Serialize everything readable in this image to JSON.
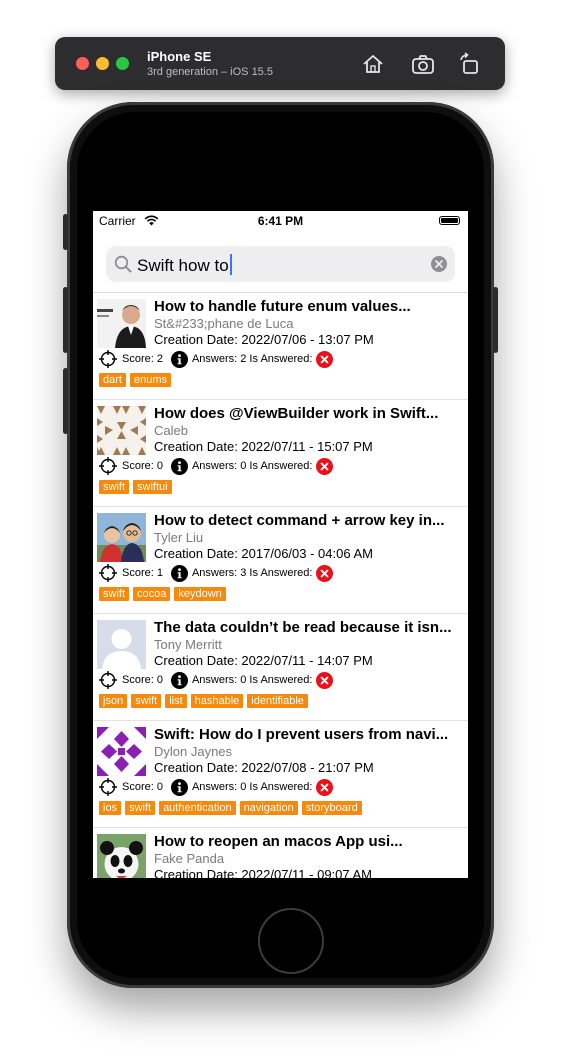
{
  "simulator": {
    "device_name": "iPhone SE",
    "device_subtitle": "3rd generation – iOS 15.5"
  },
  "status_bar": {
    "carrier": "Carrier",
    "time": "6:41 PM"
  },
  "search": {
    "query": "Swift how to"
  },
  "colors": {
    "tag_background": "#f7890c",
    "unanswered_badge": "#e8121b",
    "caret": "#3478f6"
  },
  "questions": [
    {
      "title": "How to handle future enum values...",
      "author": "St&#233;phane de Luca",
      "date": "Creation Date: 2022/07/06 - 13:07 PM",
      "score_label": "Score: 2",
      "answers_label": "Answers: 2 Is Answered:",
      "answered_icon": "x-circle-icon",
      "tags": [
        "dart",
        "enums"
      ]
    },
    {
      "title": "How does @ViewBuilder work in Swift...",
      "author": "Caleb",
      "date": "Creation Date: 2022/07/11 - 15:07 PM",
      "score_label": "Score: 0",
      "answers_label": "Answers: 0 Is Answered:",
      "answered_icon": "x-circle-icon",
      "tags": [
        "swift",
        "swiftui"
      ]
    },
    {
      "title": "How to detect command + arrow key in...",
      "author": "Tyler Liu",
      "date": "Creation Date: 2017/06/03 - 04:06 AM",
      "score_label": "Score: 1",
      "answers_label": "Answers: 3 Is Answered:",
      "answered_icon": "x-circle-icon",
      "tags": [
        "swift",
        "cocoa",
        "keydown"
      ]
    },
    {
      "title": "The data couldn’t be read because it isn...",
      "author": "Tony Merritt",
      "date": "Creation Date: 2022/07/11 - 14:07 PM",
      "score_label": "Score: 0",
      "answers_label": "Answers: 0 Is Answered:",
      "answered_icon": "x-circle-icon",
      "tags": [
        "json",
        "swift",
        "list",
        "hashable",
        "identifiable"
      ]
    },
    {
      "title": "Swift: How do I prevent users from navi...",
      "author": "Dylon Jaynes",
      "date": "Creation Date: 2022/07/08 - 21:07 PM",
      "score_label": "Score: 0",
      "answers_label": "Answers: 0 Is Answered:",
      "answered_icon": "x-circle-icon",
      "tags": [
        "ios",
        "swift",
        "authentication",
        "navigation",
        "storyboard"
      ]
    },
    {
      "title": "How to reopen an macos App usi...",
      "author": "Fake Panda",
      "date": "Creation Date: 2022/07/11 - 09:07 AM",
      "score_label": "",
      "answers_label": "",
      "answered_icon": "",
      "tags": []
    }
  ]
}
